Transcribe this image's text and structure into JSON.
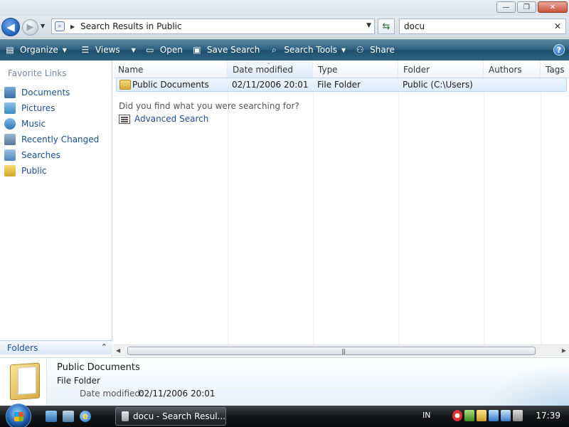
{
  "window": {
    "minimize_glyph": "—",
    "maximize_glyph": "❐",
    "close_glyph": "✕"
  },
  "address": {
    "path_label": "Search Results in Public",
    "search_value": "docu"
  },
  "commands": {
    "organize": "Organize",
    "views": "Views",
    "open": "Open",
    "save_search": "Save Search",
    "search_tools": "Search Tools",
    "share": "Share",
    "help": "?"
  },
  "nav": {
    "favorite_links_title": "Favorite Links",
    "items": [
      {
        "label": "Documents",
        "icon": "documents-icon"
      },
      {
        "label": "Pictures",
        "icon": "pictures-icon"
      },
      {
        "label": "Music",
        "icon": "music-icon"
      },
      {
        "label": "Recently Changed",
        "icon": "recently-changed-icon"
      },
      {
        "label": "Searches",
        "icon": "searches-icon"
      },
      {
        "label": "Public",
        "icon": "public-folder-icon"
      }
    ],
    "folders_label": "Folders"
  },
  "columns": [
    "Name",
    "Date modified",
    "Type",
    "Folder",
    "Authors",
    "Tags"
  ],
  "rows": [
    {
      "name": "Public Documents",
      "date_modified": "02/11/2006 20:01",
      "type": "File Folder",
      "folder": "Public (C:\\Users)",
      "authors": "",
      "tags": ""
    }
  ],
  "search_help": {
    "question": "Did you find what you were searching for?",
    "advanced_search": "Advanced Search"
  },
  "details": {
    "name": "Public Documents",
    "type": "File Folder",
    "date_modified_label": "Date modified:",
    "date_modified_value": "02/11/2006 20:01"
  },
  "taskbar": {
    "task_label": "docu - Search Resul...",
    "language": "IN",
    "clock": "17:39"
  },
  "colors": {
    "command_bar": "#2f6282",
    "link": "#1c4f8f",
    "selection": "#dcecfb"
  }
}
